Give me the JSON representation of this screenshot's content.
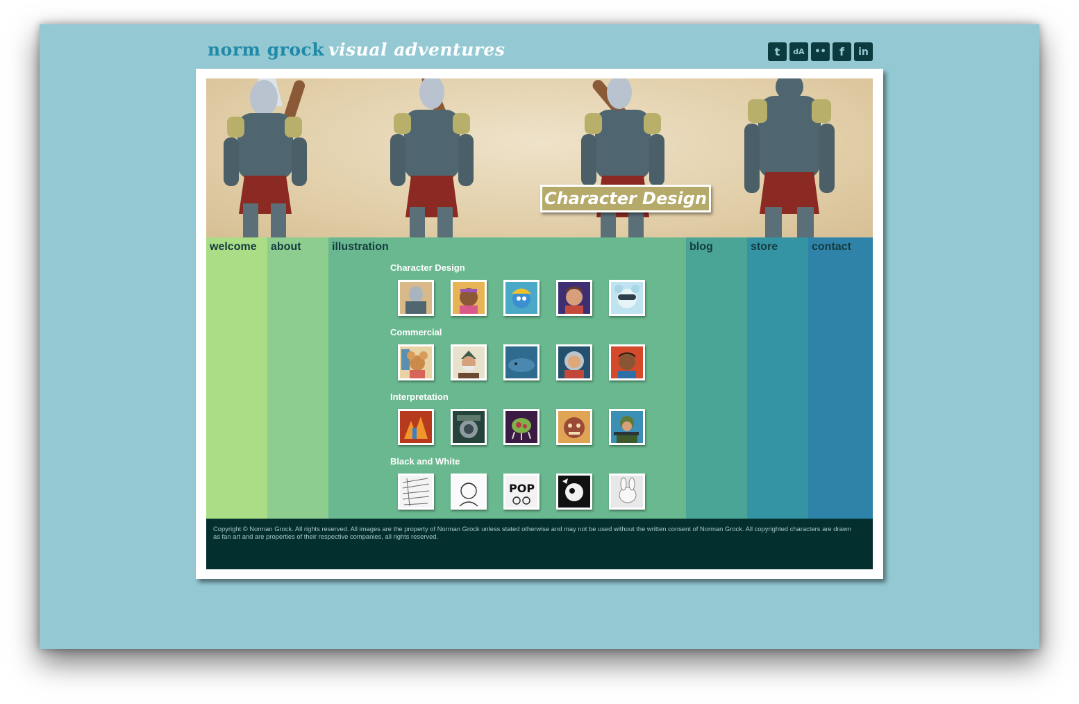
{
  "header": {
    "site_name": "norm grock",
    "tagline": "visual adventures"
  },
  "social": [
    {
      "name": "twitter-icon",
      "glyph": "t"
    },
    {
      "name": "deviantart-icon",
      "glyph": "dA"
    },
    {
      "name": "flickr-icon",
      "glyph": "••"
    },
    {
      "name": "facebook-icon",
      "glyph": "f"
    },
    {
      "name": "linkedin-icon",
      "glyph": "in"
    }
  ],
  "banner": {
    "caption": "Character Design"
  },
  "nav": {
    "welcome": "welcome",
    "about": "about",
    "illustration": "illustration",
    "blog": "blog",
    "store": "store",
    "contact": "contact"
  },
  "gallery": [
    {
      "title": "Character Design",
      "thumbs": [
        "orc-warrior",
        "girl-headband",
        "blue-creature-hardhat",
        "boy-portrait",
        "goggles-character"
      ]
    },
    {
      "title": "Commercial",
      "thumbs": [
        "mouse-character",
        "old-sailor",
        "whale",
        "astronaut-kid",
        "boy-red-background"
      ]
    },
    {
      "title": "Interpretation",
      "thumbs": [
        "fire-scene",
        "armored-figure",
        "metroid",
        "monster-face",
        "soldier"
      ]
    },
    {
      "title": "Black and White",
      "thumbs": [
        "sketch-page",
        "girl-sketch",
        "pop-comic",
        "bw-ink-circle",
        "bunny-sketch"
      ]
    }
  ],
  "footer": {
    "copyright": "Copyright © Norman Grock. All rights reserved. All images are the property of Norman Grock unless stated otherwise and may not be used without the written consent of Norman Grock. All copyrighted characters are drawn as fan art and are properties of their respective companies, all rights reserved."
  },
  "colors": {
    "page_bg": "#94c9d3",
    "welcome": "#aadd86",
    "about": "#8dcd8f",
    "illustration": "#69b88f",
    "blog": "#4aa596",
    "store": "#3494a3",
    "contact": "#2f83a8",
    "footer": "#03302f"
  }
}
